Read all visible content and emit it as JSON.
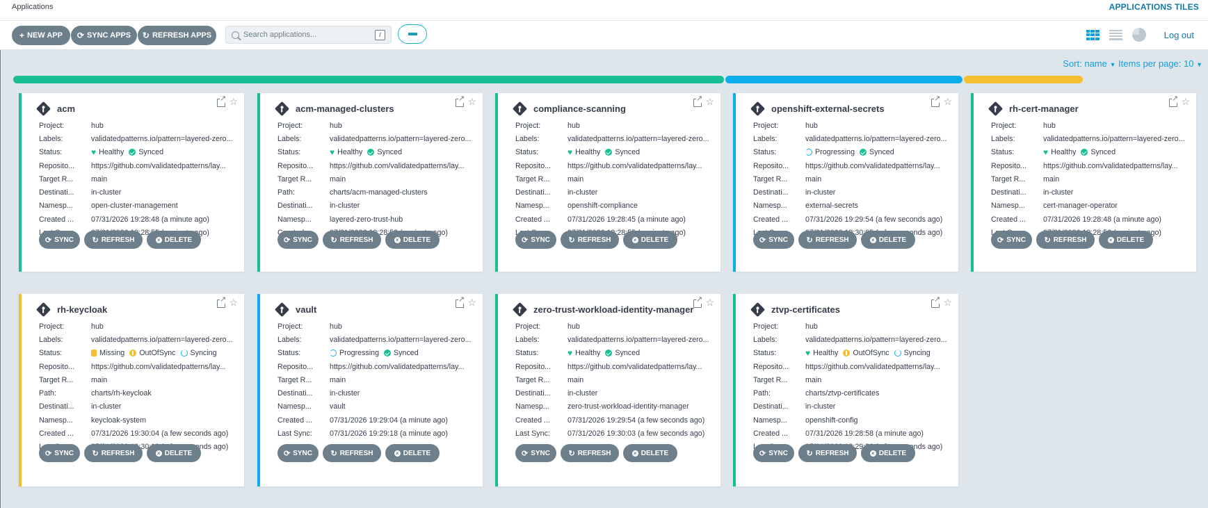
{
  "header": {
    "breadcrumb": "Applications",
    "title": "APPLICATIONS TILES"
  },
  "toolbar": {
    "new_app": "NEW APP",
    "sync_apps": "SYNC APPS",
    "refresh_apps": "REFRESH APPS",
    "search_placeholder": "Search applications...",
    "search_shortcut": "/",
    "logout": "Log out"
  },
  "sort": {
    "label": "Sort: name",
    "per_page": "Items per page: 10"
  },
  "status_bar": [
    {
      "status": "Healthy",
      "fraction": 0.6,
      "color": "#18be94"
    },
    {
      "status": "Progressing",
      "fraction": 0.2,
      "color": "#0dadea"
    },
    {
      "status": "Missing",
      "fraction": 0.1,
      "color": "#f4c030"
    }
  ],
  "colors": {
    "healthy": "#18be94",
    "progressing": "#0dadea",
    "missing": "#f4c030",
    "button": "#6d7f8b",
    "accent": "#0f79a8"
  },
  "field_labels": {
    "project": "Project:",
    "labels": "Labels:",
    "status": "Status:",
    "repo": "Reposito...",
    "target": "Target R...",
    "path": "Path:",
    "destination": "Destinati...",
    "namespace": "Namesp...",
    "created": "Created ...",
    "last_sync": "Last Sync:"
  },
  "card_actions": {
    "sync": "SYNC",
    "refresh": "REFRESH",
    "delete": "DELETE"
  },
  "apps": [
    {
      "name": "acm",
      "border": "#18be94",
      "rows": [
        {
          "k": "Project:",
          "v": "hub"
        },
        {
          "k": "Labels:",
          "v": "validatedpatterns.io/pattern=layered-zero..."
        },
        {
          "k": "Status:",
          "status": [
            {
              "icon": "heart-icon",
              "text": "Healthy"
            },
            {
              "icon": "check-circle-icon",
              "text": "Synced"
            }
          ]
        },
        {
          "k": "Reposito...",
          "v": "https://github.com/validatedpatterns/lay..."
        },
        {
          "k": "Target R...",
          "v": "main"
        },
        {
          "k": "Destinati...",
          "v": "in-cluster"
        },
        {
          "k": "Namesp...",
          "v": "open-cluster-management"
        },
        {
          "k": "Created ...",
          "v": "07/31/2026 19:28:48  (a minute ago)"
        },
        {
          "k": "Last Sync:",
          "v": "07/31/2026 19:28:55  (a minute ago)"
        }
      ]
    },
    {
      "name": "acm-managed-clusters",
      "border": "#18be94",
      "rows": [
        {
          "k": "Project:",
          "v": "hub"
        },
        {
          "k": "Labels:",
          "v": "validatedpatterns.io/pattern=layered-zero..."
        },
        {
          "k": "Status:",
          "status": [
            {
              "icon": "heart-icon",
              "text": "Healthy"
            },
            {
              "icon": "check-circle-icon",
              "text": "Synced"
            }
          ]
        },
        {
          "k": "Reposito...",
          "v": "https://github.com/validatedpatterns/lay..."
        },
        {
          "k": "Target R...",
          "v": "main"
        },
        {
          "k": "Path:",
          "v": "charts/acm-managed-clusters"
        },
        {
          "k": "Destinati...",
          "v": "in-cluster"
        },
        {
          "k": "Namesp...",
          "v": "layered-zero-trust-hub"
        },
        {
          "k": "Created ...",
          "v": "07/31/2026 19:28:53  (a minute ago)"
        }
      ]
    },
    {
      "name": "compliance-scanning",
      "border": "#18be94",
      "rows": [
        {
          "k": "Project:",
          "v": "hub"
        },
        {
          "k": "Labels:",
          "v": "validatedpatterns.io/pattern=layered-zero..."
        },
        {
          "k": "Status:",
          "status": [
            {
              "icon": "heart-icon",
              "text": "Healthy"
            },
            {
              "icon": "check-circle-icon",
              "text": "Synced"
            }
          ]
        },
        {
          "k": "Reposito...",
          "v": "https://github.com/validatedpatterns/lay..."
        },
        {
          "k": "Target R...",
          "v": "main"
        },
        {
          "k": "Destinati...",
          "v": "in-cluster"
        },
        {
          "k": "Namesp...",
          "v": "openshift-compliance"
        },
        {
          "k": "Created ...",
          "v": "07/31/2026 19:28:45  (a minute ago)"
        },
        {
          "k": "Last Sync:",
          "v": "07/31/2026 19:28:55  (a minute ago)"
        }
      ]
    },
    {
      "name": "openshift-external-secrets",
      "border": "#0dadea",
      "rows": [
        {
          "k": "Project:",
          "v": "hub"
        },
        {
          "k": "Labels:",
          "v": "validatedpatterns.io/pattern=layered-zero..."
        },
        {
          "k": "Status:",
          "status": [
            {
              "icon": "progressing-icon",
              "text": "Progressing"
            },
            {
              "icon": "check-circle-icon",
              "text": "Synced"
            }
          ]
        },
        {
          "k": "Reposito...",
          "v": "https://github.com/validatedpatterns/lay..."
        },
        {
          "k": "Target R...",
          "v": "main"
        },
        {
          "k": "Destinati...",
          "v": "in-cluster"
        },
        {
          "k": "Namesp...",
          "v": "external-secrets"
        },
        {
          "k": "Created ...",
          "v": "07/31/2026 19:29:54  (a few seconds ago)"
        },
        {
          "k": "Last Sync:",
          "v": "07/31/2026 19:30:05  (a few seconds ago)"
        }
      ]
    },
    {
      "name": "rh-cert-manager",
      "border": "#18be94",
      "rows": [
        {
          "k": "Project:",
          "v": "hub"
        },
        {
          "k": "Labels:",
          "v": "validatedpatterns.io/pattern=layered-zero..."
        },
        {
          "k": "Status:",
          "status": [
            {
              "icon": "heart-icon",
              "text": "Healthy"
            },
            {
              "icon": "check-circle-icon",
              "text": "Synced"
            }
          ]
        },
        {
          "k": "Reposito...",
          "v": "https://github.com/validatedpatterns/lay..."
        },
        {
          "k": "Target R...",
          "v": "main"
        },
        {
          "k": "Destinati...",
          "v": "in-cluster"
        },
        {
          "k": "Namesp...",
          "v": "cert-manager-operator"
        },
        {
          "k": "Created ...",
          "v": "07/31/2026 19:28:48  (a minute ago)"
        },
        {
          "k": "Last Sync:",
          "v": "07/31/2026 19:28:56  (a minute ago)"
        }
      ]
    },
    {
      "name": "rh-keycloak",
      "border": "#f4c030",
      "rows": [
        {
          "k": "Project:",
          "v": "hub"
        },
        {
          "k": "Labels:",
          "v": "validatedpatterns.io/pattern=layered-zero..."
        },
        {
          "k": "Status:",
          "status": [
            {
              "icon": "missing-icon",
              "text": "Missing"
            },
            {
              "icon": "out-of-sync-icon",
              "text": "OutOfSync"
            },
            {
              "icon": "syncing-icon",
              "text": "Syncing"
            }
          ]
        },
        {
          "k": "Reposito...",
          "v": "https://github.com/validatedpatterns/lay..."
        },
        {
          "k": "Target R...",
          "v": "main"
        },
        {
          "k": "Path:",
          "v": "charts/rh-keycloak"
        },
        {
          "k": "Destinati...",
          "v": "in-cluster"
        },
        {
          "k": "Namesp...",
          "v": "keycloak-system"
        },
        {
          "k": "Created ...",
          "v": "07/31/2026 19:30:04  (a few seconds ago)"
        },
        {
          "k": "Last Sync:",
          "v": "07/31/2026 19:30:10  (a few seconds ago)"
        }
      ]
    },
    {
      "name": "vault",
      "border": "#0dadea",
      "rows": [
        {
          "k": "Project:",
          "v": "hub"
        },
        {
          "k": "Labels:",
          "v": "validatedpatterns.io/pattern=layered-zero..."
        },
        {
          "k": "Status:",
          "status": [
            {
              "icon": "progressing-icon",
              "text": "Progressing"
            },
            {
              "icon": "check-circle-icon",
              "text": "Synced"
            }
          ]
        },
        {
          "k": "Reposito...",
          "v": "https://github.com/validatedpatterns/lay..."
        },
        {
          "k": "Target R...",
          "v": "main"
        },
        {
          "k": "Destinati...",
          "v": "in-cluster"
        },
        {
          "k": "Namesp...",
          "v": "vault"
        },
        {
          "k": "Created ...",
          "v": "07/31/2026 19:29:04  (a minute ago)"
        },
        {
          "k": "Last Sync:",
          "v": "07/31/2026 19:29:18  (a minute ago)"
        }
      ]
    },
    {
      "name": "zero-trust-workload-identity-manager",
      "border": "#18be94",
      "rows": [
        {
          "k": "Project:",
          "v": "hub"
        },
        {
          "k": "Labels:",
          "v": "validatedpatterns.io/pattern=layered-zero..."
        },
        {
          "k": "Status:",
          "status": [
            {
              "icon": "heart-icon",
              "text": "Healthy"
            },
            {
              "icon": "check-circle-icon",
              "text": "Synced"
            }
          ]
        },
        {
          "k": "Reposito...",
          "v": "https://github.com/validatedpatterns/lay..."
        },
        {
          "k": "Target R...",
          "v": "main"
        },
        {
          "k": "Destinati...",
          "v": "in-cluster"
        },
        {
          "k": "Namesp...",
          "v": "zero-trust-workload-identity-manager"
        },
        {
          "k": "Created ...",
          "v": "07/31/2026 19:29:54  (a few seconds ago)"
        },
        {
          "k": "Last Sync:",
          "v": "07/31/2026 19:30:03  (a few seconds ago)"
        }
      ]
    },
    {
      "name": "ztvp-certificates",
      "border": "#18be94",
      "rows": [
        {
          "k": "Project:",
          "v": "hub"
        },
        {
          "k": "Labels:",
          "v": "validatedpatterns.io/pattern=layered-zero..."
        },
        {
          "k": "Status:",
          "status": [
            {
              "icon": "heart-icon",
              "text": "Healthy"
            },
            {
              "icon": "out-of-sync-icon",
              "text": "OutOfSync"
            },
            {
              "icon": "syncing-icon",
              "text": "Syncing"
            }
          ]
        },
        {
          "k": "Reposito...",
          "v": "https://github.com/validatedpatterns/lay..."
        },
        {
          "k": "Target R...",
          "v": "main"
        },
        {
          "k": "Path:",
          "v": "charts/ztvp-certificates"
        },
        {
          "k": "Destinati...",
          "v": "in-cluster"
        },
        {
          "k": "Namesp...",
          "v": "openshift-config"
        },
        {
          "k": "Created ...",
          "v": "07/31/2026 19:28:58  (a minute ago)"
        },
        {
          "k": "Last Sync:",
          "v": "07/31/2026 19:29:38  (a few seconds ago)"
        }
      ]
    }
  ]
}
